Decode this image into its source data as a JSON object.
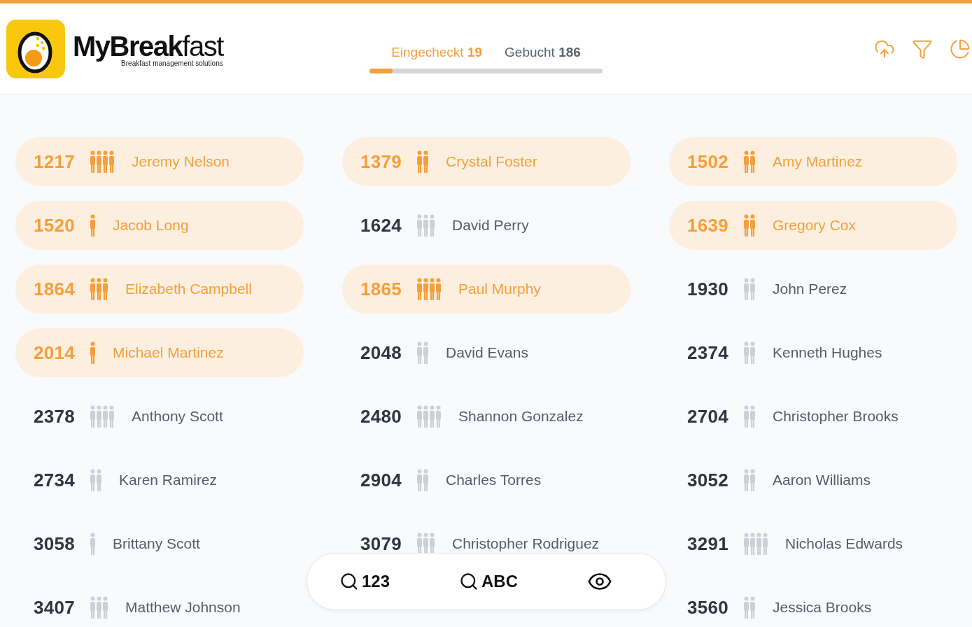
{
  "logo": {
    "name": "**MyBreak**fast",
    "tagline": "Breakfast management solutions"
  },
  "tabs": [
    {
      "label": "Eingecheckt",
      "count": "19",
      "selected": true
    },
    {
      "label": "Gebucht",
      "count": "186",
      "selected": false
    }
  ],
  "progress": {
    "level": 0.1
  },
  "rooms": [
    {
      "number": "1217",
      "name": "Jeremy Nelson",
      "kind": "four",
      "checked_in": true
    },
    {
      "number": "1379",
      "name": "Crystal Foster",
      "kind": "two",
      "checked_in": true
    },
    {
      "number": "1502",
      "name": "Amy Martinez",
      "kind": "two",
      "checked_in": true
    },
    {
      "number": "1520",
      "name": "Jacob Long",
      "kind": "one",
      "checked_in": true
    },
    {
      "number": "1624",
      "name": "David Perry",
      "kind": "three",
      "checked_in": false
    },
    {
      "number": "1639",
      "name": "Gregory Cox",
      "kind": "two",
      "checked_in": true
    },
    {
      "number": "1864",
      "name": "Elizabeth Campbell",
      "kind": "three",
      "checked_in": true
    },
    {
      "number": "1865",
      "name": "Paul Murphy",
      "kind": "four",
      "checked_in": true
    },
    {
      "number": "1930",
      "name": "John Perez",
      "kind": "two",
      "checked_in": false
    },
    {
      "number": "2014",
      "name": "Michael Martinez",
      "kind": "one",
      "checked_in": true
    },
    {
      "number": "2048",
      "name": "David Evans",
      "kind": "two",
      "checked_in": false
    },
    {
      "number": "2374",
      "name": "Kenneth Hughes",
      "kind": "two",
      "checked_in": false
    },
    {
      "number": "2378",
      "name": "Anthony Scott",
      "kind": "four",
      "checked_in": false
    },
    {
      "number": "2480",
      "name": "Shannon Gonzalez",
      "kind": "four",
      "checked_in": false
    },
    {
      "number": "2704",
      "name": "Christopher Brooks",
      "kind": "two",
      "checked_in": false
    },
    {
      "number": "2734",
      "name": "Karen Ramirez",
      "kind": "two",
      "checked_in": false
    },
    {
      "number": "2904",
      "name": "Charles Torres",
      "kind": "two",
      "checked_in": false
    },
    {
      "number": "3052",
      "name": "Aaron Williams",
      "kind": "two",
      "checked_in": false
    },
    {
      "number": "3058",
      "name": "Brittany Scott",
      "kind": "one",
      "checked_in": false
    },
    {
      "number": "3079",
      "name": "Christopher Rodriguez",
      "kind": "three",
      "checked_in": false
    },
    {
      "number": "3291",
      "name": "Nicholas Edwards",
      "kind": "four",
      "checked_in": false
    },
    {
      "number": "3407",
      "name": "Matthew Johnson",
      "kind": "three",
      "checked_in": false
    },
    {
      "number": "3560",
      "name": "Jessica Brooks",
      "kind": "two",
      "checked_in": false
    }
  ],
  "toolbar": {
    "number_search": "123",
    "name_search": "ABC"
  }
}
